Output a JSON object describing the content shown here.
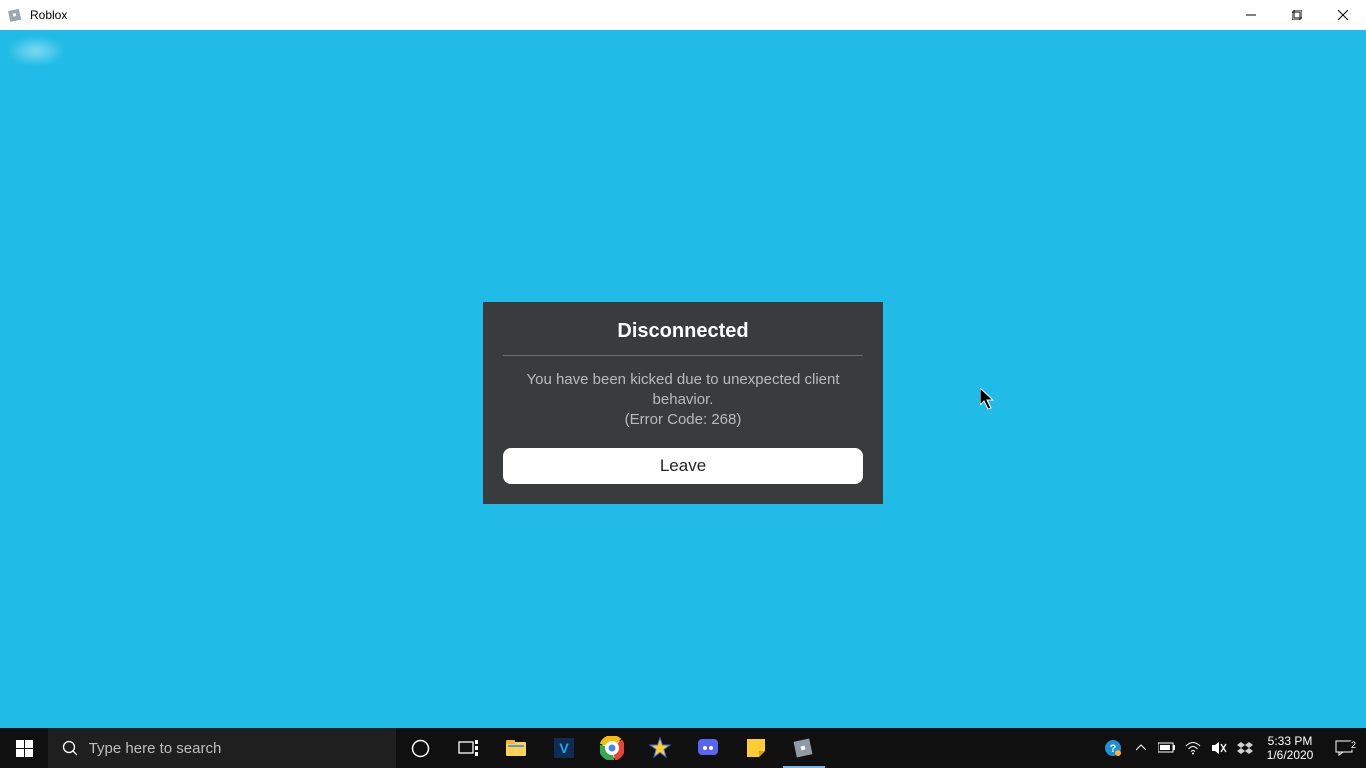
{
  "window": {
    "title": "Roblox",
    "controls": {
      "minimize": "—",
      "maximize": "❐",
      "close": "✕"
    }
  },
  "dialog": {
    "title": "Disconnected",
    "message_line1": "You have been kicked due to unexpected client",
    "message_line2": "behavior.",
    "error_code_line": "(Error Code: 268)",
    "button_label": "Leave"
  },
  "taskbar": {
    "search_placeholder": "Type here to search",
    "apps": [
      {
        "name": "file-explorer"
      },
      {
        "name": "visual-studio"
      },
      {
        "name": "google-chrome"
      },
      {
        "name": "star-app"
      },
      {
        "name": "discord"
      },
      {
        "name": "notes-app"
      },
      {
        "name": "roblox",
        "active": true
      }
    ],
    "clock": {
      "time": "5:33 PM",
      "date": "1/6/2020"
    },
    "action_center_badge": "2"
  },
  "colors": {
    "viewport_bg": "#20bce7",
    "modal_bg": "#393b3d",
    "taskbar_bg": "#101010"
  }
}
